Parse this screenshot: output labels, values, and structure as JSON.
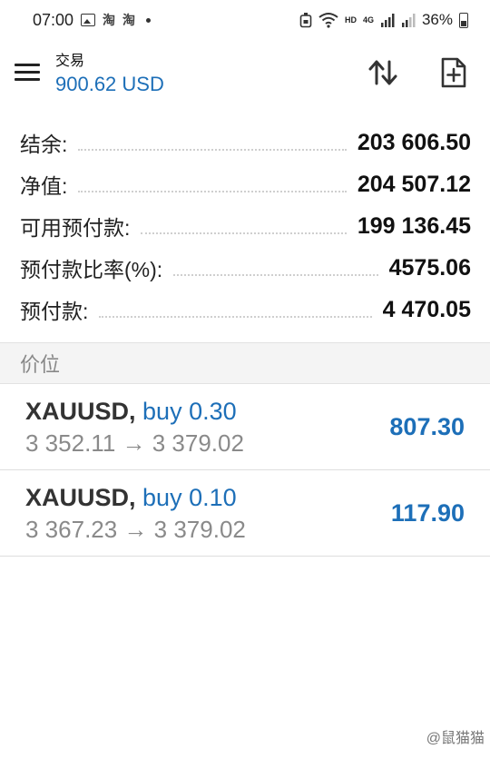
{
  "status_bar": {
    "time": "07:00",
    "app_icon_1": "淘",
    "app_icon_2": "淘",
    "network": "4G",
    "hd": "HD",
    "battery": "36%",
    "icons": [
      "image-icon",
      "taobao-icon",
      "dot-icon",
      "vpn-icon",
      "wifi-icon",
      "signal-icon",
      "battery-icon"
    ]
  },
  "header": {
    "title": "交易",
    "balance": "900.62 USD",
    "icons": [
      "menu-icon",
      "sort-icon",
      "new-order-icon"
    ]
  },
  "summary": [
    {
      "label": "结余:",
      "value": "203 606.50"
    },
    {
      "label": "净值:",
      "value": "204 507.12"
    },
    {
      "label": "可用预付款:",
      "value": "199 136.45"
    },
    {
      "label": "预付款比率(%):",
      "value": "4575.06"
    },
    {
      "label": "预付款:",
      "value": "4 470.05"
    }
  ],
  "section": {
    "title": "价位"
  },
  "positions": [
    {
      "symbol": "XAUUSD,",
      "side": "buy 0.30",
      "prices": "3 352.11 → 3 379.02",
      "profit": "807.30"
    },
    {
      "symbol": "XAUUSD,",
      "side": "buy 0.10",
      "prices": "3 367.23 → 3 379.02",
      "profit": "117.90"
    }
  ],
  "watermark": "@鼠猫猫",
  "colors": {
    "accent": "#1d6fb8",
    "text": "#111111",
    "muted": "#8a8a8a",
    "section_bg": "#f4f4f4"
  }
}
